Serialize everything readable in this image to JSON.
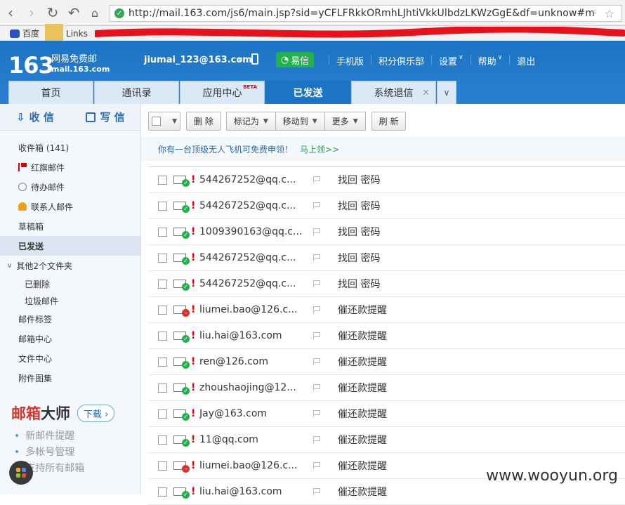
{
  "browser": {
    "url": "http://mail.163.com/js6/main.jsp?sid=yCFLFRkkORmhLJhtiVkkUlbdzLKWzGgE&df=unknow#m",
    "bookmarks": [
      "百度",
      "Links"
    ]
  },
  "header": {
    "logo_num": "163",
    "logo_line1": "网易免费邮",
    "logo_line2": "mail.163.com",
    "user": "jiumai_123@163.com",
    "yixin": "易信",
    "links": [
      "手机版",
      "积分俱乐部",
      "设置",
      "帮助",
      "退出"
    ]
  },
  "tabs": [
    {
      "label": "首页"
    },
    {
      "label": "通讯录"
    },
    {
      "label": "应用中心",
      "badge": "BETA"
    },
    {
      "label": "已发送"
    },
    {
      "label": "系统退信"
    }
  ],
  "sidebar": {
    "receive": "收 信",
    "compose": "写 信",
    "folders": [
      {
        "label": "收件箱 (141)"
      },
      {
        "label": "红旗邮件"
      },
      {
        "label": "待办邮件"
      },
      {
        "label": "联系人邮件"
      },
      {
        "label": "草稿箱"
      },
      {
        "label": "已发送"
      },
      {
        "label": "其他2个文件夹"
      },
      {
        "label": "已删除"
      },
      {
        "label": "垃圾邮件"
      },
      {
        "label": "邮件标签"
      },
      {
        "label": "邮箱中心"
      },
      {
        "label": "文件中心"
      },
      {
        "label": "附件图集"
      }
    ],
    "master_a": "邮箱",
    "master_b": "大师",
    "download": "下载",
    "features": [
      "新邮件提醒",
      "多帐号管理",
      "支持所有邮箱"
    ]
  },
  "toolbar": {
    "delete": "删 除",
    "mark": "标记为",
    "move": "移动到",
    "more": "更多",
    "refresh": "刷 新"
  },
  "promo": {
    "text": "你有一台顶级无人飞机可免费申领！",
    "link": "马上领>>"
  },
  "mails": [
    {
      "to": "544267252@qq.c...",
      "subject": "找回 密码",
      "status": "ok"
    },
    {
      "to": "544267252@qq.c...",
      "subject": "找回 密码",
      "status": "ok"
    },
    {
      "to": "1009390163@qq.c...",
      "subject": "找回 密码",
      "status": "ok"
    },
    {
      "to": "544267252@qq.c...",
      "subject": "找回 密码",
      "status": "ok"
    },
    {
      "to": "544267252@qq.c...",
      "subject": "找回 密码",
      "status": "ok"
    },
    {
      "to": "liumei.bao@126.c...",
      "subject": "催还款提醒",
      "status": "fail"
    },
    {
      "to": "liu.hai@163.com",
      "subject": "催还款提醒",
      "status": "ok"
    },
    {
      "to": "ren@126.com",
      "subject": "催还款提醒",
      "status": "ok"
    },
    {
      "to": "zhoushaojing@12...",
      "subject": "催还款提醒",
      "status": "ok"
    },
    {
      "to": "Jay@163.com",
      "subject": "催还款提醒",
      "status": "ok"
    },
    {
      "to": "11@qq.com",
      "subject": "催还款提醒",
      "status": "ok"
    },
    {
      "to": "liumei.bao@126.c...",
      "subject": "催还款提醒",
      "status": "fail"
    },
    {
      "to": "liu.hai@163.com",
      "subject": "催还款提醒",
      "status": "ok"
    }
  ],
  "watermark": "www.wooyun.org",
  "colors": {
    "brand": "#1b74c6",
    "ok": "#22b14c",
    "fail": "#d9342b"
  }
}
